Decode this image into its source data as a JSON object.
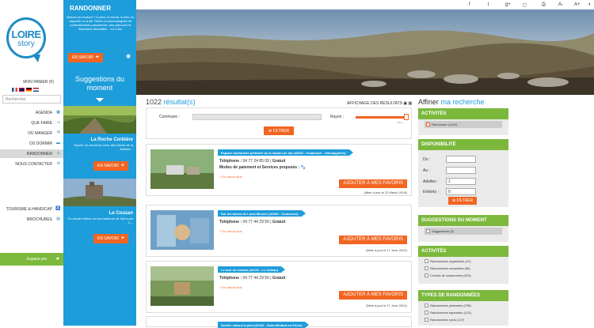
{
  "logo": {
    "line1": "LOIRE",
    "line2": "story"
  },
  "leftnav": {
    "panier": "MON PANIER (0)",
    "search_placeholder": "Rechercher",
    "items": [
      "AGENDA",
      "QUE FAIRE",
      "OÙ MANGER",
      "OÙ DORMIR",
      "RANDONNER",
      "NOUS CONTACTER"
    ],
    "tourisme": "TOURISME & HANDICAP",
    "brochures": "BROCHURES",
    "espace_pro": "Espace pro"
  },
  "bluebar": {
    "title": "RANDONNER",
    "intro": "Besoin de verdure ? À pied, à cheval, à vélo, en raquette ou à ski. Seuls ou accompagnés de professionnels passionnés, des parcours et itinéraires diversifiés... en Loire.",
    "en_savoir": "EN SAVOIR",
    "suggestions_title": "Suggestions du moment",
    "sug1_title": "La Roche Corbière",
    "sug1_text": "Sportif, ce circuit au cœur des Monts de la Madele...",
    "sug2_title": "Le Couzan",
    "sug2_text": "Ce circuit s'élève sur les hauteurs de Sail sous C..."
  },
  "results": {
    "count": "1022",
    "label": "résultat(s)",
    "affichage": "AFFICHAGE DES RÉSULTATS",
    "commune_label": "Commune :",
    "rayon_label": "Rayon :",
    "rayon_value": "20km",
    "filtrer": "FILTRER"
  },
  "cards": [
    {
      "title": "Espace randonnée pédestre de la station de ski (42920 - Chalmazel - Jeansagnière)",
      "tel_label": "Téléphone :",
      "tel": "04 77 24 85 09",
      "prix": "Gratuit",
      "modes": "Modes de paiement et Services proposés :",
      "plus": "+ En savoir plus",
      "fav": "AJOUTER À MES FAVORIS",
      "maj": "(Mise à jour le 22 March 2018)"
    },
    {
      "title": "Sur les traces de Louis Mercier (42460 - Coutouvre)",
      "tel_label": "Téléphone :",
      "tel": "04 77 44 29 50",
      "prix": "Gratuit",
      "plus": "+ En savoir plus",
      "fav": "AJOUTER À MES FAVORIS",
      "maj": "(Mise à jour le 17 June 2021)"
    },
    {
      "title": "Le tour du Coteau (42120 - Le Coteau)",
      "tel_label": "Téléphone :",
      "tel": "04 77 44 29 50",
      "prix": "Gratuit",
      "plus": "+ En savoir plus",
      "fav": "AJOUTER À MES FAVORIS",
      "maj": "(Mise à jour le 17 June 2021)"
    },
    {
      "title": "Sentier naturel à pied (42130 - Saint-Médard-en-Forez)"
    }
  ],
  "sidebar": {
    "affiner": "Affiner",
    "ma_recherche": "ma recherche",
    "activites_title": "ACTIVITÉS",
    "activite_selected": "Randonner (1022)",
    "dispo_title": "DISPONIBILITÉ",
    "du": "Du :",
    "au": "Au :",
    "adultes": "Adultes :",
    "adultes_val": "1",
    "enfants": "Enfants :",
    "enfants_val": "0",
    "filtrer": "FILTRER",
    "sugg_title": "SUGGESTIONS DU MOMENT",
    "sugg_opt": "Suggestions (5)",
    "act2_title": "ACTIVITÉS",
    "act2_opts": [
      "Randonnées organisées (47)",
      "Randonnées encadrées (56)",
      "Circuits de randonnées (913)"
    ],
    "types_title": "TYPES DE RANDONNÉES",
    "types_opts": [
      "Randonnées pédestres (708)",
      "Randonnées équestres (123)",
      "Randonnées cyclo (137)"
    ]
  },
  "colors": {
    "blue": "#1e9ddb",
    "orange": "#f26522",
    "green": "#7cb83c"
  }
}
